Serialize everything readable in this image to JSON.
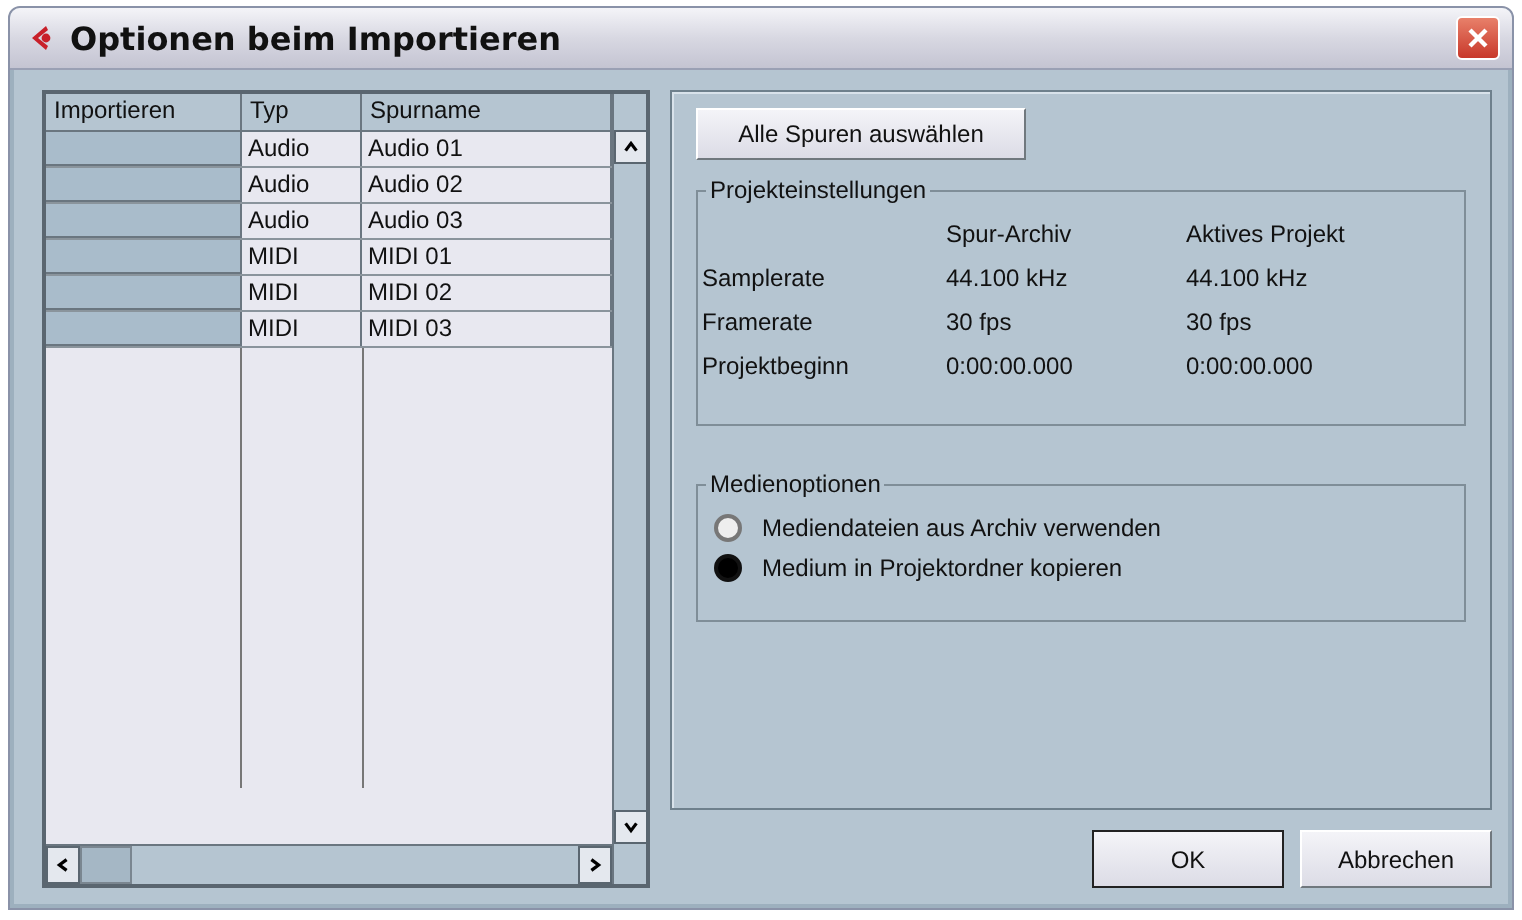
{
  "window": {
    "title": "Optionen beim Importieren"
  },
  "table": {
    "columns": [
      "Importieren",
      "Typ",
      "Spurname"
    ],
    "rows": [
      {
        "type": "Audio",
        "name": "Audio 01"
      },
      {
        "type": "Audio",
        "name": "Audio 02"
      },
      {
        "type": "Audio",
        "name": "Audio 03"
      },
      {
        "type": "MIDI",
        "name": "MIDI 01"
      },
      {
        "type": "MIDI",
        "name": "MIDI 02"
      },
      {
        "type": "MIDI",
        "name": "MIDI 03"
      }
    ]
  },
  "select_all_button": "Alle Spuren auswählen",
  "project_settings": {
    "title": "Projekteinstellungen",
    "columns": [
      "Spur-Archiv",
      "Aktives Projekt"
    ],
    "rows": [
      {
        "label": "Samplerate",
        "values": [
          "44.100 kHz",
          "44.100 kHz"
        ]
      },
      {
        "label": "Framerate",
        "values": [
          "30 fps",
          "30 fps"
        ]
      },
      {
        "label": "Projektbeginn",
        "values": [
          "0:00:00.000",
          "0:00:00.000"
        ]
      }
    ]
  },
  "media_options": {
    "title": "Medienoptionen",
    "options": [
      {
        "label": "Mediendateien aus Archiv verwenden",
        "selected": false
      },
      {
        "label": "Medium in Projektordner kopieren",
        "selected": true
      }
    ]
  },
  "buttons": [
    "OK",
    "Abbrechen"
  ]
}
